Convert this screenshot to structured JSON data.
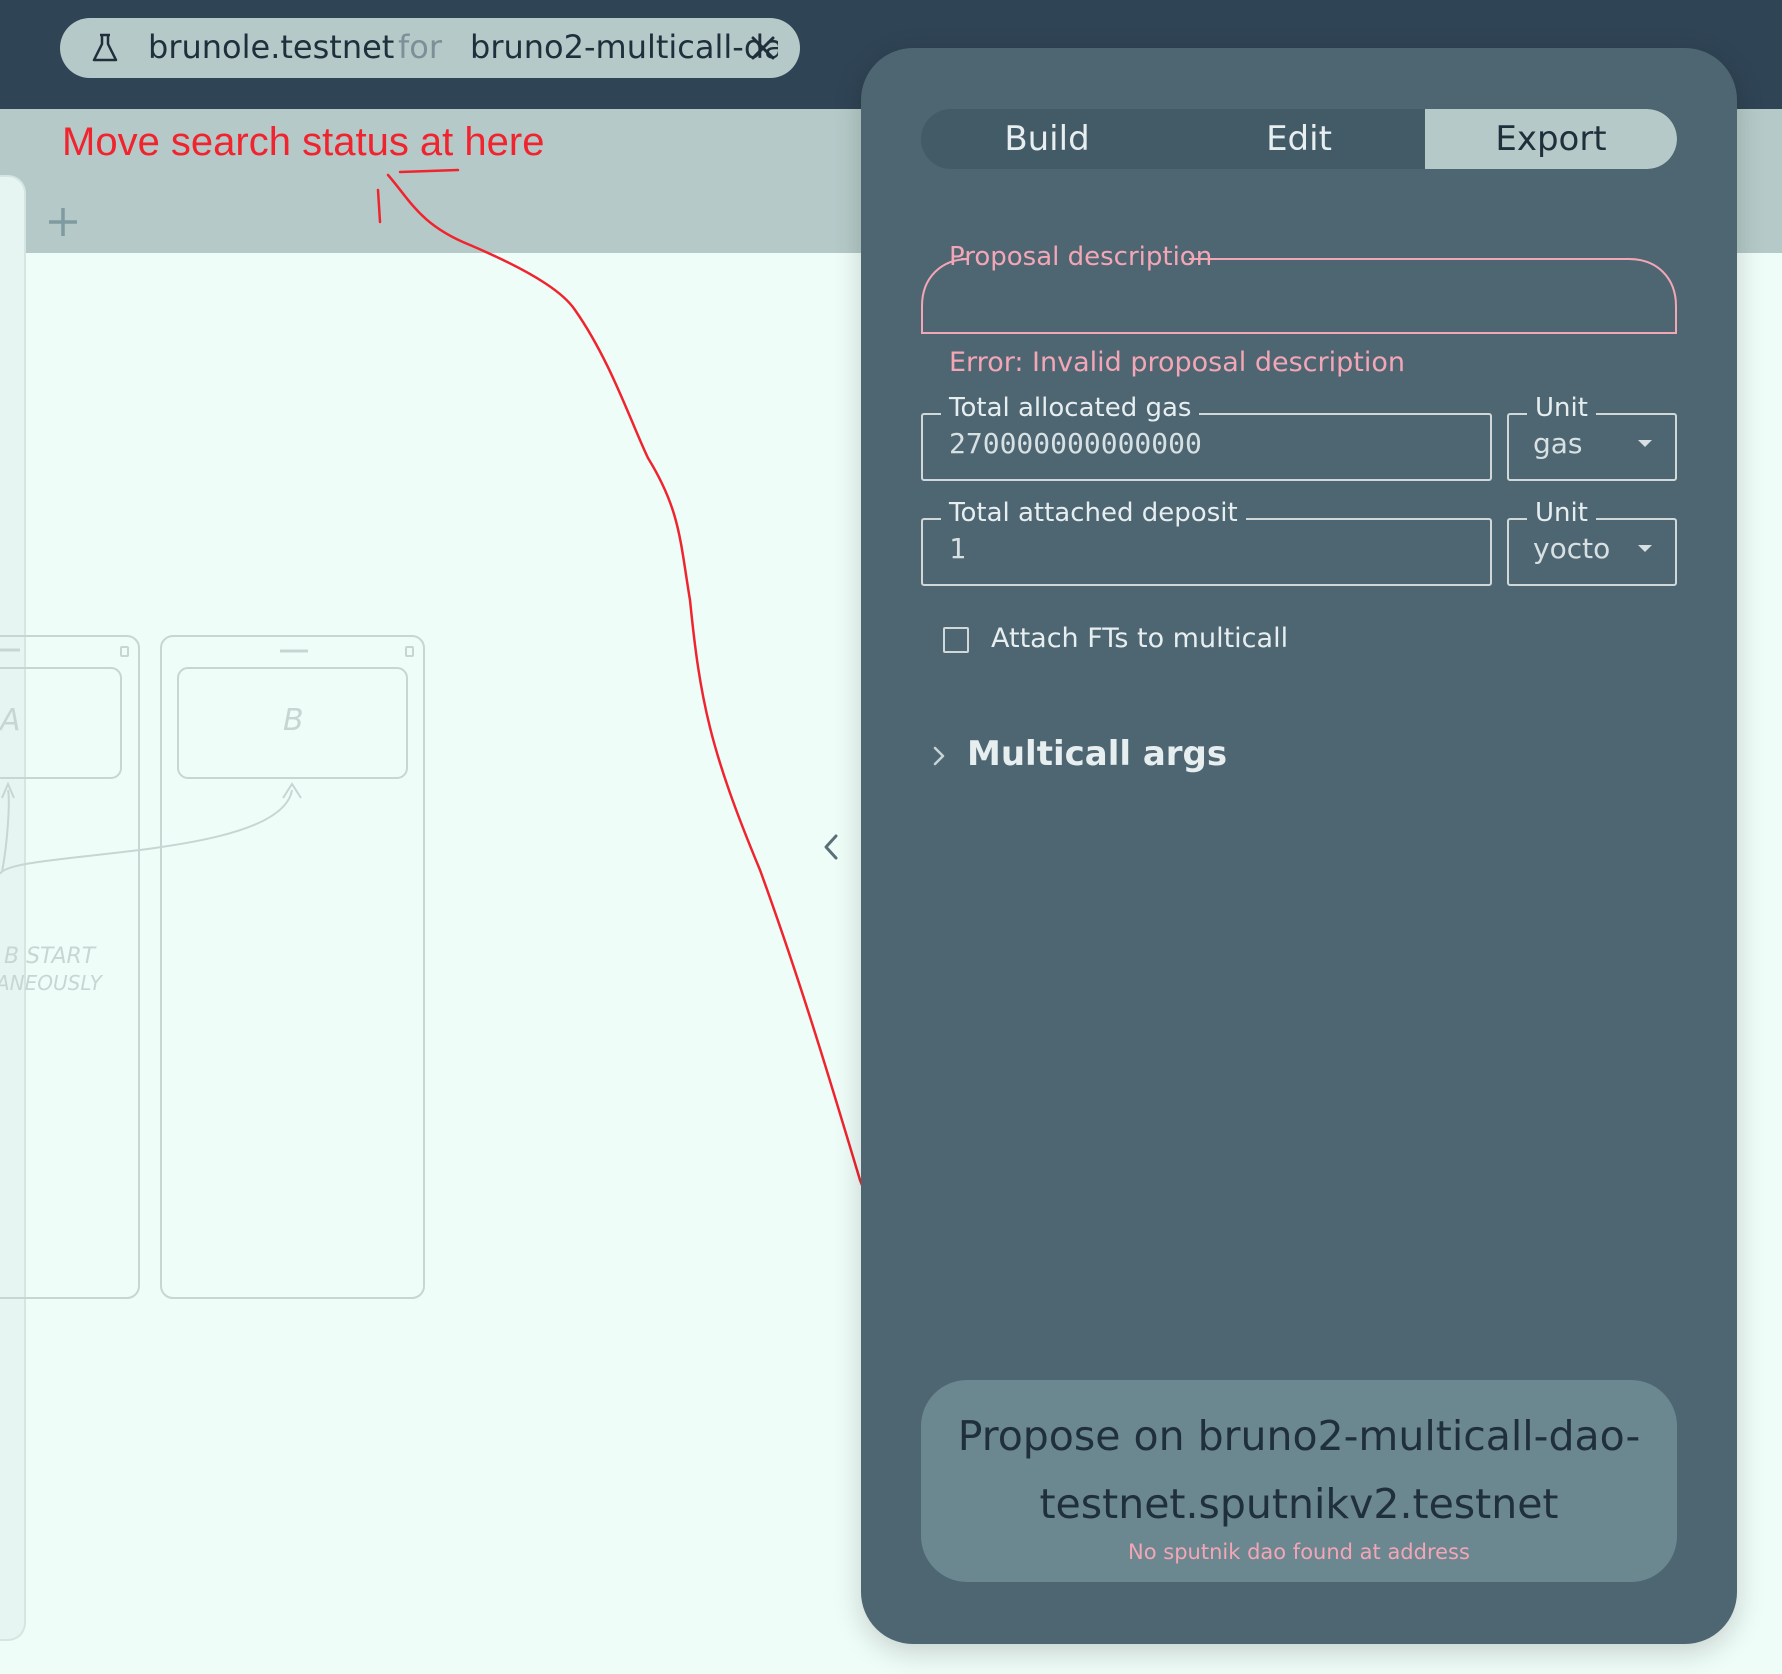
{
  "header": {
    "user": "brunole.testnet",
    "for_label": "for",
    "dao": "bruno2-multicall-dao"
  },
  "annotation": {
    "text": "Move search status at here",
    "color": "#f0242e"
  },
  "canvas": {
    "tasks": [
      "A",
      "B"
    ],
    "note_lines": [
      "B START",
      "ANEOUSLY"
    ]
  },
  "panel": {
    "tabs": [
      {
        "label": "Build",
        "active": false
      },
      {
        "label": "Edit",
        "active": false
      },
      {
        "label": "Export",
        "active": true
      }
    ],
    "proposal_description": {
      "label": "Proposal description",
      "value": "",
      "error": "Error: Invalid proposal description"
    },
    "gas": {
      "label": "Total allocated gas",
      "value": "270000000000000",
      "unit_label": "Unit",
      "unit_value": "gas"
    },
    "deposit": {
      "label": "Total attached deposit",
      "value": "1",
      "unit_label": "Unit",
      "unit_value": "yocto"
    },
    "attach_fts": {
      "label": "Attach FTs to multicall",
      "checked": false
    },
    "multicall_args": {
      "label": "Multicall args",
      "expanded": false
    },
    "propose": {
      "label": "Propose on bruno2-multicall-dao-testnet.sputnikv2.testnet",
      "sub": "No sputnik dao found at address"
    }
  },
  "colors": {
    "topbar": "#2f4455",
    "panel": "#4e6672",
    "accent": "#b5cac8",
    "error": "#f2a6b6",
    "canvas": "#effdf9"
  }
}
